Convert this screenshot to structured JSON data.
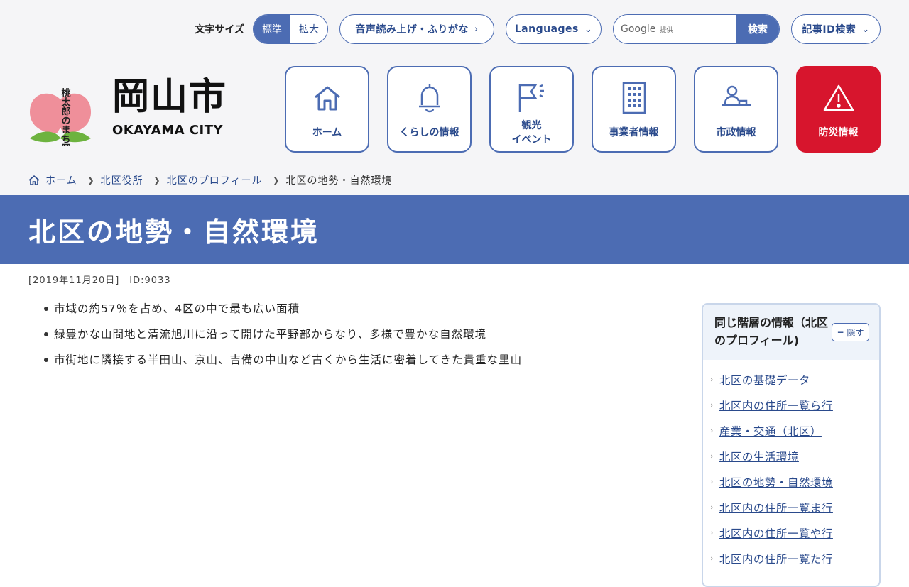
{
  "util": {
    "font_size_label": "文字サイズ",
    "font_size_options": [
      "標準",
      "拡大"
    ],
    "read_aloud": "音声読み上げ・ふりがな",
    "languages": "Languages",
    "search_google": "Google",
    "search_provided": "提供",
    "search_button": "検索",
    "article_id_search": "記事ID検索"
  },
  "logo": {
    "kanji": "岡山市",
    "english": "OKAYAMA CITY",
    "mascot_text": "桃太郎のまち岡山"
  },
  "nav": [
    {
      "label": "ホーム",
      "icon": "home-icon"
    },
    {
      "label": "くらしの情報",
      "icon": "bell-icon"
    },
    {
      "label": "観光\nイベント",
      "icon": "flag-icon"
    },
    {
      "label": "事業者情報",
      "icon": "building-icon"
    },
    {
      "label": "市政情報",
      "icon": "person-podium-icon"
    },
    {
      "label": "防災情報",
      "icon": "warning-icon"
    }
  ],
  "breadcrumb": [
    "ホーム",
    "北区役所",
    "北区のプロフィール",
    "北区の地勢・自然環境"
  ],
  "page": {
    "title": "北区の地勢・自然環境",
    "meta": "[2019年11月20日]　ID:9033",
    "bullets": [
      "市域の約57％を占め、4区の中で最も広い面積",
      "緑豊かな山間地と清流旭川に沿って開けた平野部からなり、多様で豊かな自然環境",
      "市街地に隣接する半田山、京山、吉備の中山など古くから生活に密着してきた貴重な里山"
    ]
  },
  "sidebar": {
    "title": "同じ階層の情報（北区のプロフィール)",
    "hide_label": "隠す",
    "links": [
      "北区の基礎データ",
      "北区内の住所一覧ら行",
      "産業・交通（北区）",
      "北区の生活環境",
      "北区の地勢・自然環境",
      "北区内の住所一覧ま行",
      "北区内の住所一覧や行",
      "北区内の住所一覧た行"
    ]
  },
  "colors": {
    "primary": "#4c6cb3",
    "danger": "#d7152d",
    "link": "#2a4a8c"
  }
}
